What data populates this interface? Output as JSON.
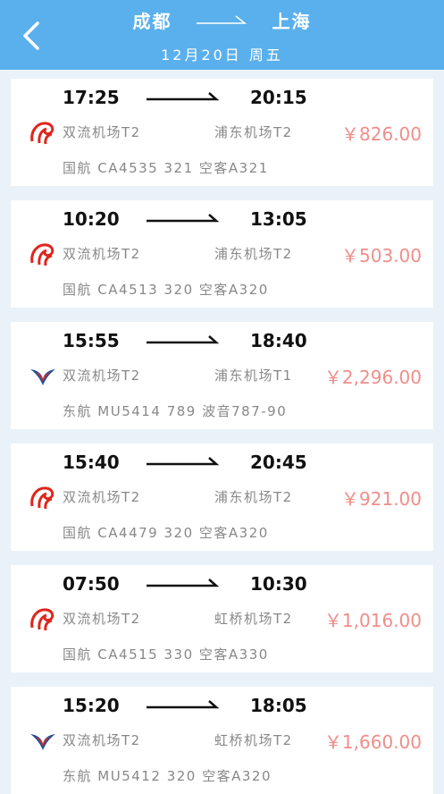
{
  "header": {
    "from_city": "成都",
    "to_city": "上海",
    "date": "12月20日",
    "weekday": "周五",
    "back_icon": "chevron-left-icon",
    "color": "#5ab0ec"
  },
  "flights": [
    {
      "dep": "17:25",
      "arr": "20:15",
      "from_airport": "双流机场T2",
      "to_airport": "浦东机场T2",
      "price": "￥826.00",
      "airline": "国航",
      "flight_no": "CA4535",
      "plane_code": "321",
      "plane_model": "空客A321",
      "logo": "air-china-logo"
    },
    {
      "dep": "10:20",
      "arr": "13:05",
      "from_airport": "双流机场T2",
      "to_airport": "浦东机场T2",
      "price": "￥503.00",
      "airline": "国航",
      "flight_no": "CA4513",
      "plane_code": "320",
      "plane_model": "空客A320",
      "logo": "air-china-logo"
    },
    {
      "dep": "15:55",
      "arr": "18:40",
      "from_airport": "双流机场T2",
      "to_airport": "浦东机场T1",
      "price": "￥2,296.00",
      "airline": "东航",
      "flight_no": "MU5414",
      "plane_code": "789",
      "plane_model": "波音787-90",
      "logo": "china-eastern-logo"
    },
    {
      "dep": "15:40",
      "arr": "20:45",
      "from_airport": "双流机场T2",
      "to_airport": "浦东机场T2",
      "price": "￥921.00",
      "airline": "国航",
      "flight_no": "CA4479",
      "plane_code": "320",
      "plane_model": "空客A320",
      "logo": "air-china-logo"
    },
    {
      "dep": "07:50",
      "arr": "10:30",
      "from_airport": "双流机场T2",
      "to_airport": "虹桥机场T2",
      "price": "￥1,016.00",
      "airline": "国航",
      "flight_no": "CA4515",
      "plane_code": "330",
      "plane_model": "空客A330",
      "logo": "air-china-logo"
    },
    {
      "dep": "15:20",
      "arr": "18:05",
      "from_airport": "双流机场T2",
      "to_airport": "虹桥机场T2",
      "price": "￥1,660.00",
      "airline": "东航",
      "flight_no": "MU5412",
      "plane_code": "320",
      "plane_model": "空客A320",
      "logo": "china-eastern-logo"
    }
  ],
  "colors": {
    "price": "#f08e8a",
    "air_china_red": "#e0251b",
    "eastern_blue": "#1b4f9c",
    "eastern_red": "#d42a2a"
  }
}
